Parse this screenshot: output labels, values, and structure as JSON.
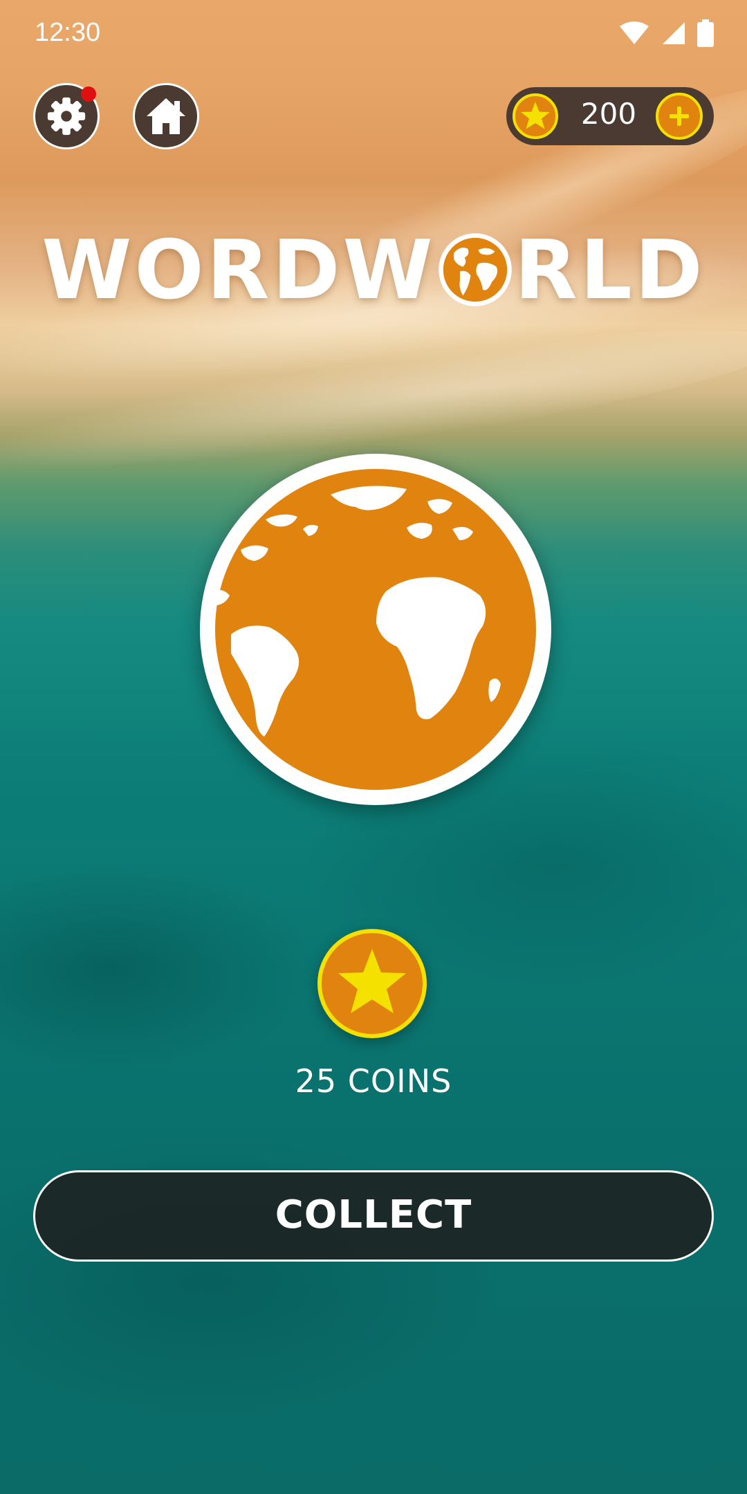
{
  "status_bar": {
    "time": "12:30",
    "icons": [
      "wifi-icon",
      "cell-signal-icon",
      "battery-icon"
    ]
  },
  "top_bar": {
    "settings": {
      "icon": "gear-icon",
      "has_notification": true
    },
    "home": {
      "icon": "home-icon"
    },
    "coin_balance": "200",
    "add_coins_icon": "plus-icon"
  },
  "logo": {
    "part1": "WORDW",
    "part2": "RLD"
  },
  "reward": {
    "label": "25 COINS",
    "icon": "star-coin-icon"
  },
  "collect_button": {
    "label": "COLLECT"
  },
  "colors": {
    "accent_orange": "#e0830f",
    "coin_yellow": "#f5e100",
    "pill_brown": "#4a3a31",
    "button_dark": "#1e2020"
  }
}
